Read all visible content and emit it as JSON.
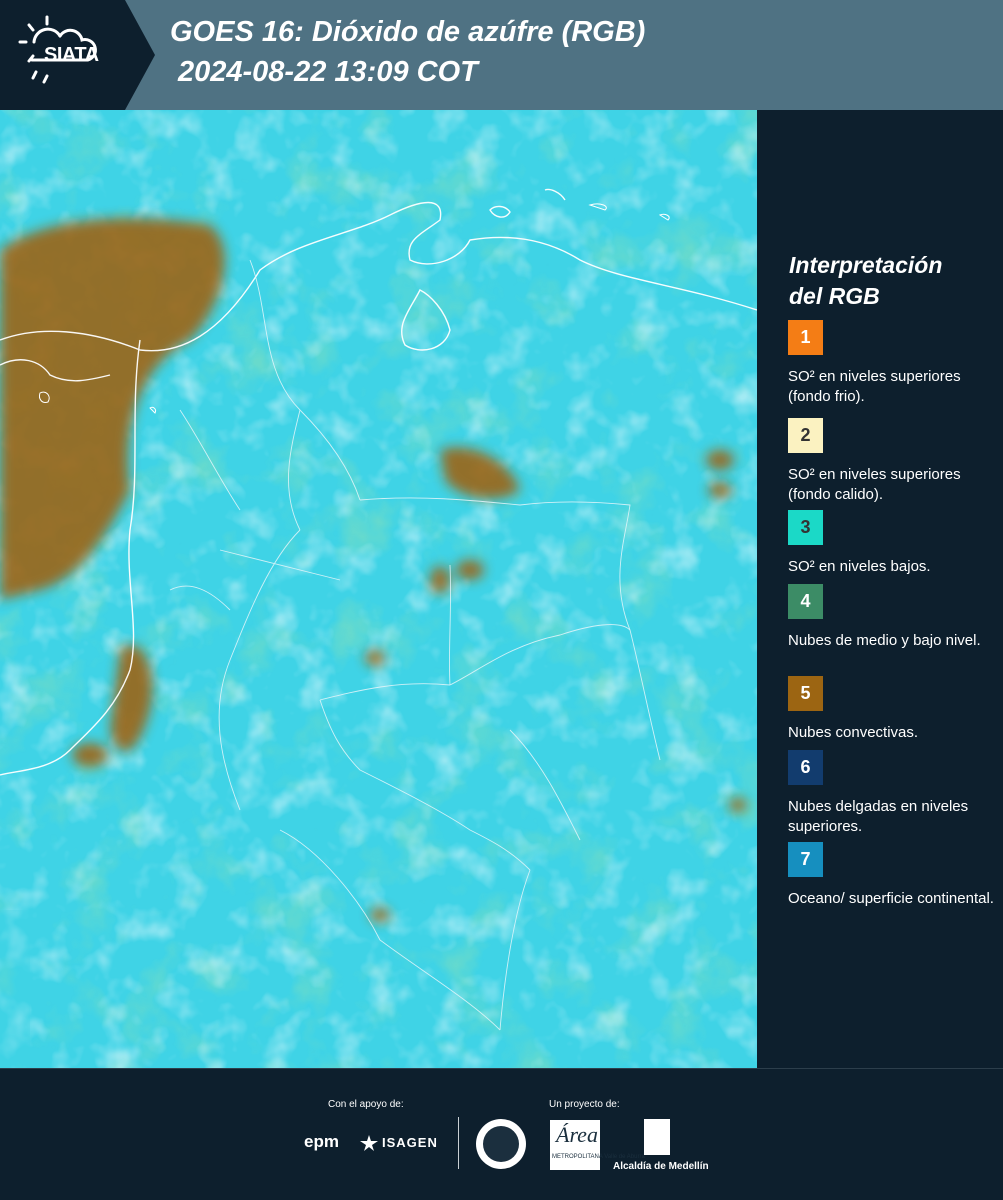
{
  "header": {
    "logo_text": "SIATA",
    "title_line_1": "GOES 16: Dióxido de azúfre (RGB)",
    "title_line_2": "2024-08-22 13:09 COT"
  },
  "legend": {
    "title_line_1": "Interpretación",
    "title_line_2": "del RGB",
    "items": [
      {
        "number": "1",
        "color": "#f47d15",
        "text": "SO² en niveles superiores (fondo frio)."
      },
      {
        "number": "2",
        "color": "#fbf2c1",
        "text": "SO² en niveles superiores (fondo calido)."
      },
      {
        "number": "3",
        "color": "#1bd9c7",
        "text": "SO² en niveles bajos."
      },
      {
        "number": "4",
        "color": "#3c8c66",
        "text": "Nubes de medio y bajo nivel."
      },
      {
        "number": "5",
        "color": "#9c6512",
        "text": "Nubes convectivas."
      },
      {
        "number": "6",
        "color": "#123c6e",
        "text": "Nubes delgadas en niveles superiores."
      },
      {
        "number": "7",
        "color": "#168fbf",
        "text": "Oceano/ superficie continental."
      }
    ]
  },
  "footer": {
    "support_label": "Con el apoyo de:",
    "project_label": "Un proyecto de:",
    "sponsor_1": "epm",
    "sponsor_2": "ISAGEN",
    "partner_area": "Área",
    "partner_area_sub": "METROPOLITANA Valle de Aburrá",
    "partner_alcaldia": "Alcaldía de Medellín"
  },
  "colors": {
    "header_bg": "#4f7283",
    "panel_bg": "#0d1f2d",
    "ocean_cyan": "#3fd3e6",
    "convective_brown": "#9c6512"
  }
}
